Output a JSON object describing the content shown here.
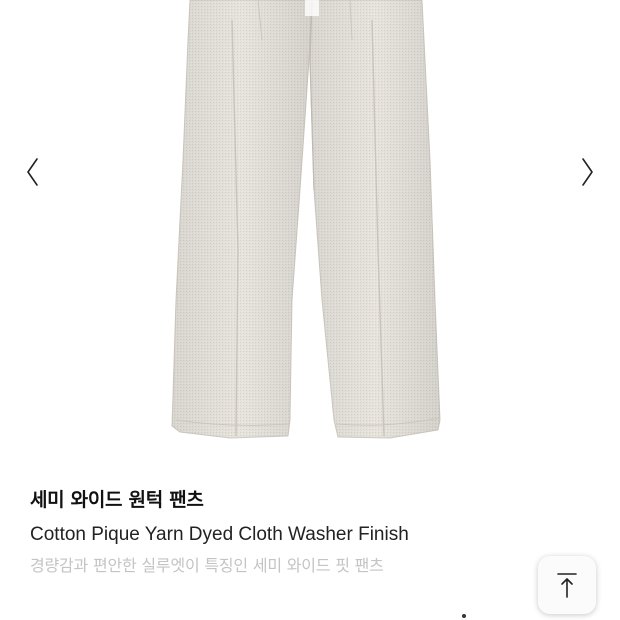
{
  "gallery": {
    "image_icon": "pants-product-photo",
    "prev_icon": "chevron-left-icon",
    "next_icon": "chevron-right-icon",
    "fabric_color": "#e4e1db"
  },
  "product": {
    "title": "세미 와이드 원턱 팬츠",
    "subtitle": "Cotton Pique Yarn Dyed Cloth Washer Finish",
    "description": "경량감과 편안한 실루엣이 특징인 세미 와이드 핏 팬츠"
  },
  "scroll_top": {
    "icon": "arrow-up-to-top-icon"
  }
}
